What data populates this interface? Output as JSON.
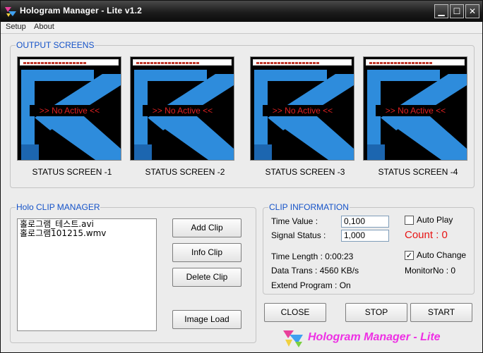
{
  "window": {
    "title": "Hologram Manager - Lite  v1.2",
    "controls": {
      "minimize": "▁",
      "maximize": "☐",
      "close": "✕"
    }
  },
  "menu": {
    "items": [
      "Setup",
      "About"
    ]
  },
  "output_screens": {
    "legend": "OUTPUT SCREENS",
    "screens": [
      {
        "label": "STATUS SCREEN -1",
        "status": ">> No Active <<"
      },
      {
        "label": "STATUS SCREEN -2",
        "status": ">> No Active <<"
      },
      {
        "label": "STATUS SCREEN -3",
        "status": ">> No Active <<"
      },
      {
        "label": "STATUS SCREEN -4",
        "status": ">> No Active <<"
      }
    ]
  },
  "clip_manager": {
    "legend": "Holo CLIP MANAGER",
    "clips": [
      "홀로그램_테스트.avi",
      "홀로그램101215.wmv"
    ],
    "buttons": {
      "add": "Add    Clip",
      "info": "Info    Clip",
      "delete": "Delete Clip",
      "image_load": "Image Load"
    }
  },
  "clip_info": {
    "legend": "CLIP INFORMATION",
    "time_value_label": "Time Value   :",
    "time_value": "0,100",
    "signal_status_label": "Signal Status  :",
    "signal_status": "1,000",
    "auto_play_label": "Auto Play",
    "auto_play_checked": false,
    "count_text": "Count : 0",
    "time_length": "Time Length   : 0:00:23",
    "data_trans": "Data Trans     : 4560 KB/s",
    "extend_program": "Extend Program : On",
    "auto_change_label": "Auto Change",
    "auto_change_checked": true,
    "monitor_no": "MonitorNo : 0"
  },
  "actions": {
    "close": "CLOSE",
    "stop": "STOP",
    "start": "START"
  },
  "brand": {
    "text": "Hologram Manager - Lite"
  },
  "colors": {
    "accent": "#1452c8",
    "count": "#e81414",
    "brand": "#ee30e4",
    "screen_blue": "#2e8cdc"
  }
}
